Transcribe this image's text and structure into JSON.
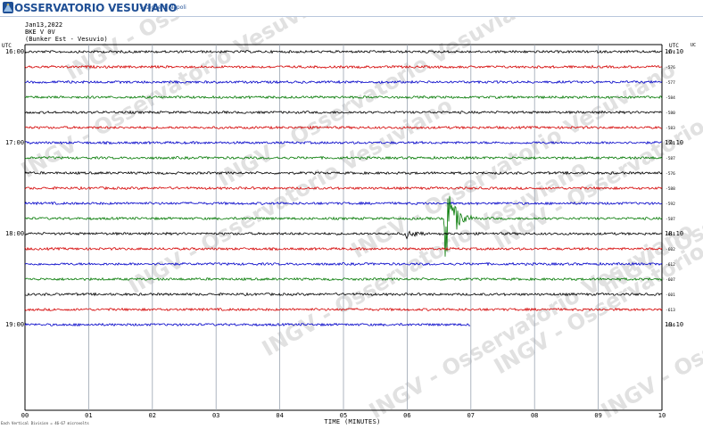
{
  "header": {
    "logo_icon": "vesuvius-volcano-icon",
    "title": "OSSERVATORIO VESUVIANO",
    "subtitle": "Sezione di Napoli",
    "date": "Jan13,2022",
    "station": "BKE V 0V",
    "location": "(Bunker Est - Vesuvio)",
    "utc_left": "UTC",
    "utc_right": "UTC",
    "right_column_header": "UC"
  },
  "watermark": "INGV - Osservatorio Vesuviano",
  "footer": {
    "scale_note": "Each Vertical Division = 46-67 microvolts"
  },
  "colors": {
    "banner_text": "#1f4f95",
    "trace_cycle": [
      "#000000",
      "#d40000",
      "#0000c8",
      "#007800"
    ],
    "grid": "#9aa3b0",
    "watermark": "#e1e1e1"
  },
  "chart_data": {
    "type": "line",
    "title": "",
    "xlabel": "TIME (MINUTES)",
    "ylabel": "",
    "xlim": [
      0,
      10
    ],
    "x_ticks": [
      "00",
      "01",
      "02",
      "03",
      "04",
      "05",
      "06",
      "07",
      "08",
      "09",
      "10"
    ],
    "grid": true,
    "trace_minutes_per_line": 10,
    "hour_labels_left": [
      "16:00",
      "17:00",
      "18:00",
      "19:00"
    ],
    "hour_labels_right": [
      "16:10",
      "17:10",
      "18:10",
      "19:10"
    ],
    "hour_label_trace_index": [
      0,
      6,
      12,
      18
    ],
    "trace_count": 19,
    "last_trace_end_minute": 7.0,
    "trace_values_right": [
      "-574",
      "-576",
      "-577",
      "-584",
      "-580",
      "-583",
      "-581",
      "-587",
      "-576",
      "-588",
      "-592",
      "-587",
      "-611",
      "-602",
      "-612",
      "-607",
      "-601",
      "-613",
      "-616"
    ],
    "events": [
      {
        "trace_index": 11,
        "minute": 6.6,
        "type": "local earthquake",
        "amplitude_divisions": 2.8,
        "color": "#007800"
      },
      {
        "trace_index": 12,
        "minute": 6.0,
        "type": "minor transient",
        "amplitude_divisions": 0.3,
        "color": "#000000"
      }
    ]
  }
}
